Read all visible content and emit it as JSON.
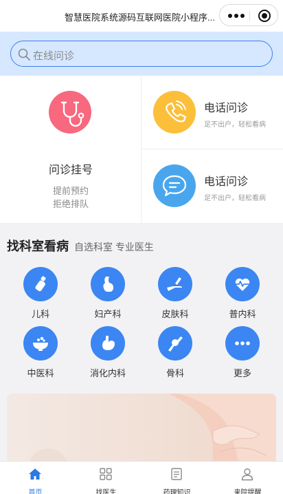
{
  "header": {
    "title": "智慧医院系统源码互联网医院小程序..."
  },
  "search": {
    "placeholder": "在线问诊"
  },
  "services": {
    "main": {
      "title": "问诊挂号",
      "line1": "提前预约",
      "line2": "拒绝排队",
      "icon": "stethoscope-icon",
      "color": "#f8687e"
    },
    "items": [
      {
        "title": "电话问诊",
        "subtitle": "足不出户，轻松看病",
        "icon": "phone-icon",
        "color": "#fbbf3a"
      },
      {
        "title": "电话问诊",
        "subtitle": "足不出户，轻松看病",
        "icon": "chat-bubble-icon",
        "color": "#4aa6ec"
      }
    ]
  },
  "departments": {
    "title": "找科室看病",
    "subtitle": "自选科室 专业医生",
    "accent": "#3b86f2",
    "items": [
      {
        "label": "儿科",
        "icon": "baby-bottle-icon"
      },
      {
        "label": "妇产科",
        "icon": "pregnancy-icon"
      },
      {
        "label": "皮肤科",
        "icon": "skin-care-icon"
      },
      {
        "label": "普内科",
        "icon": "heartbeat-icon"
      },
      {
        "label": "中医科",
        "icon": "herbal-bowl-icon"
      },
      {
        "label": "消化内科",
        "icon": "stomach-icon"
      },
      {
        "label": "骨科",
        "icon": "bone-joint-icon"
      },
      {
        "label": "更多",
        "icon": "more-dots-icon"
      }
    ]
  },
  "tabbar": {
    "active_color": "#2a7ae2",
    "items": [
      {
        "label": "首页",
        "icon": "home-icon",
        "active": true
      },
      {
        "label": "找医生",
        "icon": "grid-icon",
        "active": false
      },
      {
        "label": "药理知识",
        "icon": "document-icon",
        "active": false
      },
      {
        "label": "来院提醒",
        "icon": "user-icon",
        "active": false
      }
    ]
  }
}
